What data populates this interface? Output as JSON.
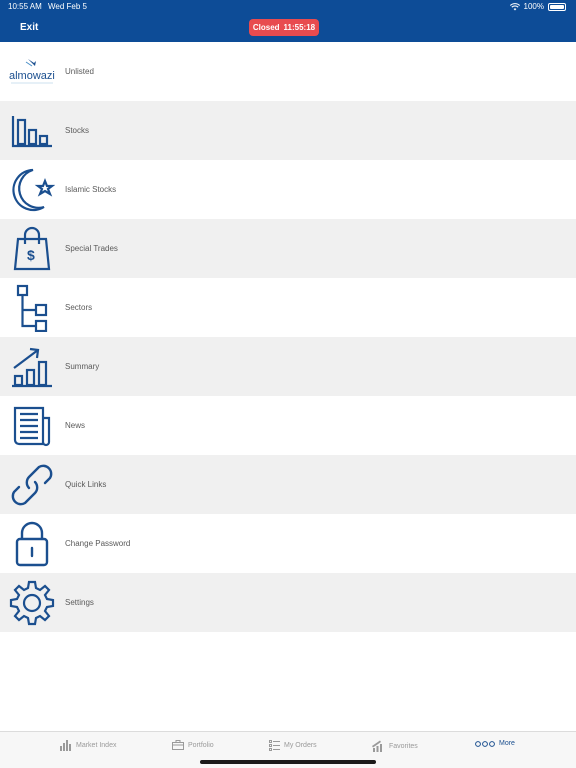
{
  "status_bar": {
    "time": "10:55 AM",
    "date": "Wed Feb 5",
    "battery": "100%"
  },
  "header": {
    "exit_label": "Exit",
    "market_status": "Closed",
    "market_time": "11:55:18"
  },
  "brand": {
    "logo_text": "almowazi",
    "primary_color": "#0d4c97",
    "closed_color": "#e84b4f"
  },
  "menu": [
    {
      "label": "Unlisted",
      "icon": "almowazi-logo"
    },
    {
      "label": "Stocks",
      "icon": "bar-chart-icon"
    },
    {
      "label": "Islamic Stocks",
      "icon": "crescent-star-icon"
    },
    {
      "label": "Special Trades",
      "icon": "shopping-bag-dollar-icon"
    },
    {
      "label": "Sectors",
      "icon": "hierarchy-icon"
    },
    {
      "label": "Summary",
      "icon": "trend-chart-icon"
    },
    {
      "label": "News",
      "icon": "newspaper-icon"
    },
    {
      "label": "Quick Links",
      "icon": "link-icon"
    },
    {
      "label": "Change Password",
      "icon": "lock-icon"
    },
    {
      "label": "Settings",
      "icon": "gear-icon"
    }
  ],
  "tabs": [
    {
      "label": "Market Index",
      "icon": "bar-chart-icon"
    },
    {
      "label": "Portfolio",
      "icon": "briefcase-icon"
    },
    {
      "label": "My Orders",
      "icon": "list-icon"
    },
    {
      "label": "Favorites",
      "icon": "trend-chart-icon"
    },
    {
      "label": "More",
      "icon": "more-dots-icon",
      "active": true
    }
  ]
}
